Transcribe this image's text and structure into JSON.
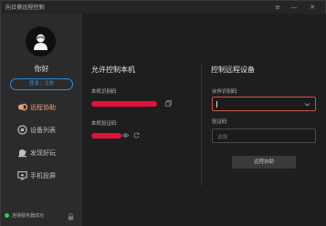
{
  "window": {
    "title": "向日葵远程控制",
    "controls": {
      "menu": "≡",
      "minimize": "—",
      "close": "✕"
    }
  },
  "sidebar": {
    "greeting": "你好",
    "login_button": "登录 / 注册",
    "items": [
      {
        "label": "远程协助",
        "icon": "remote-assist-icon",
        "active": true
      },
      {
        "label": "设备列表",
        "icon": "device-list-icon",
        "active": false
      },
      {
        "label": "发现好玩",
        "icon": "discover-icon",
        "active": false
      },
      {
        "label": "手机投屏",
        "icon": "screen-cast-icon",
        "active": false
      }
    ],
    "status_text": "连接服务器成功",
    "status_color": "#2ecc4f"
  },
  "allow_panel": {
    "title": "允许控制本机",
    "id_label": "本机识别码",
    "password_label": "本机验证码"
  },
  "control_panel": {
    "title": "控制远程设备",
    "partner_label": "伙伴识别码",
    "partner_value": "",
    "code_label": "验证码",
    "code_placeholder": "选填",
    "connect_button": "远程协助"
  },
  "colors": {
    "accent": "#2f8fe6",
    "active_nav": "#e8a07c",
    "redaction": "#e5103c",
    "focus_border": "#c6564b"
  }
}
